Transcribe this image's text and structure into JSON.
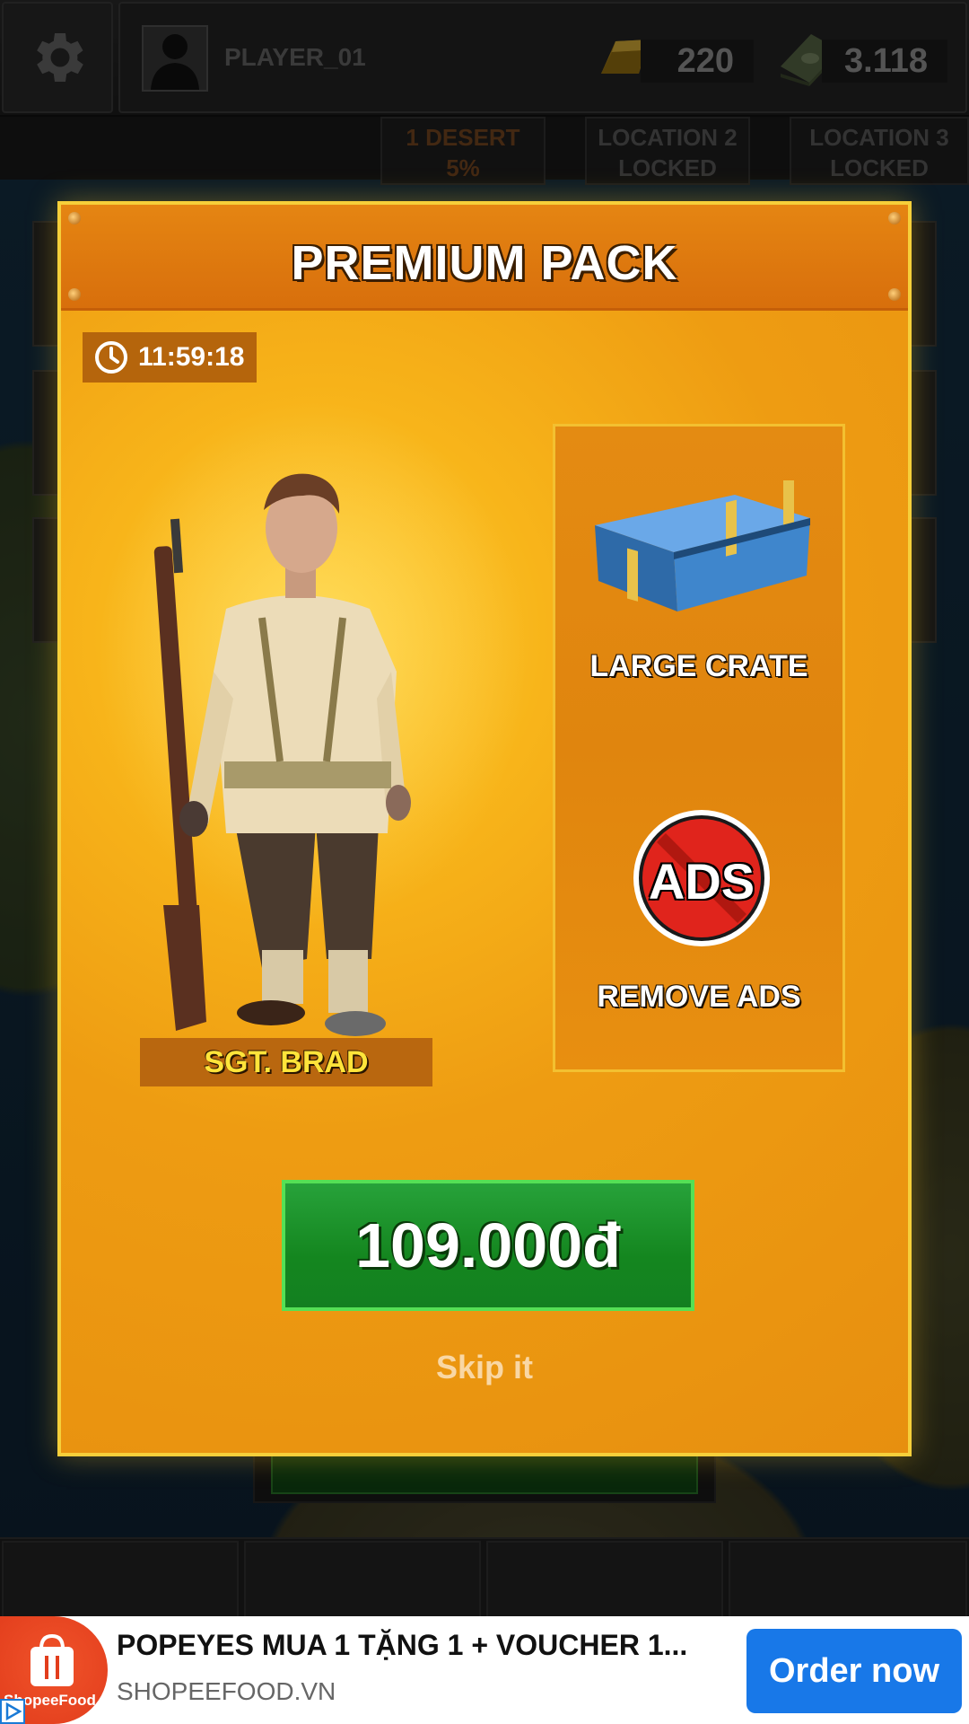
{
  "topbar": {
    "player_name": "PLAYER_01",
    "gold": "220",
    "cash": "3.118"
  },
  "locations": [
    {
      "line1": "1 DESERT",
      "line2": "5%"
    },
    {
      "line1": "LOCATION 2",
      "line2": "LOCKED"
    },
    {
      "line1": "LOCATION 3",
      "line2": "LOCKED"
    }
  ],
  "modal": {
    "title": "PREMIUM PACK",
    "timer": "11:59:18",
    "character_name": "SGT. BRAD",
    "rewards": [
      {
        "label": "LARGE CRATE",
        "icon": "crate-icon"
      },
      {
        "label": "REMOVE ADS",
        "icon": "no-ads-icon",
        "badge_text": "ADS"
      }
    ],
    "price": "109.000đ",
    "skip_label": "Skip it"
  },
  "ad": {
    "title": "POPEYES MUA 1 TẶNG 1 + VOUCHER 1...",
    "url": "SHOPEEFOOD.VN",
    "logo_text": "ShopeeFood",
    "cta": "Order now"
  },
  "colors": {
    "modal_border": "#f6cf3a",
    "modal_bg": "#ee9c12",
    "price_button": "#14861f",
    "name_text": "#ffe43a",
    "ad_cta": "#1878e8"
  }
}
